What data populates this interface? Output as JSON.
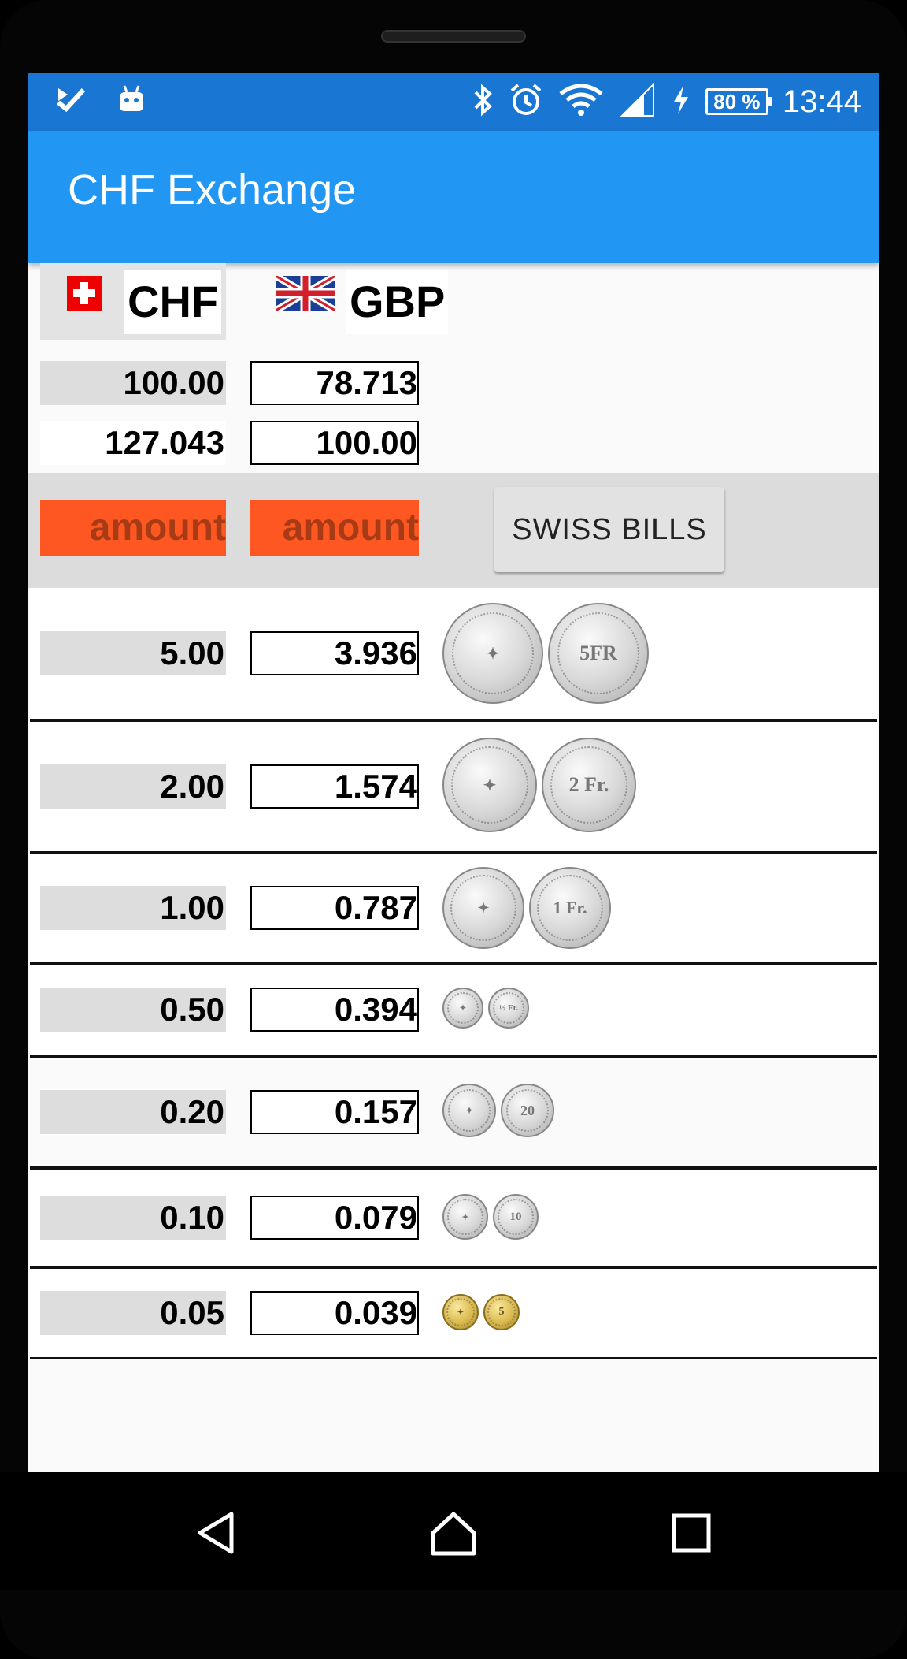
{
  "status_bar": {
    "time": "13:44",
    "battery": "80 %",
    "icons": [
      "check-notification-icon",
      "android-icon",
      "bluetooth-icon",
      "alarm-icon",
      "wifi-icon",
      "signal-icon",
      "charging-icon"
    ]
  },
  "app_bar": {
    "title": "CHF Exchange"
  },
  "currencies": {
    "from": {
      "code": "CHF",
      "flag": "swiss-flag-icon"
    },
    "to": {
      "code": "GBP",
      "flag": "uk-flag-icon"
    }
  },
  "rates": [
    {
      "chf": "100.00",
      "gbp": "78.713"
    },
    {
      "chf": "127.043",
      "gbp": "100.00"
    }
  ],
  "inputs": {
    "chf_placeholder": "amount",
    "gbp_placeholder": "amount",
    "bills_button": "SWISS BILLS"
  },
  "coins": [
    {
      "chf": "5.00",
      "gbp": "3.936",
      "back_label": "5FR",
      "color": "silver"
    },
    {
      "chf": "2.00",
      "gbp": "1.574",
      "back_label": "2 Fr.",
      "color": "silver"
    },
    {
      "chf": "1.00",
      "gbp": "0.787",
      "back_label": "1 Fr.",
      "color": "silver"
    },
    {
      "chf": "0.50",
      "gbp": "0.394",
      "back_label": "½ Fr.",
      "color": "silver"
    },
    {
      "chf": "0.20",
      "gbp": "0.157",
      "back_label": "20",
      "color": "silver"
    },
    {
      "chf": "0.10",
      "gbp": "0.079",
      "back_label": "10",
      "color": "silver"
    },
    {
      "chf": "0.05",
      "gbp": "0.039",
      "back_label": "5",
      "color": "gold"
    }
  ],
  "colors": {
    "status_bar": "#1976d2",
    "app_bar": "#2196f3",
    "amount_input": "#ff5722"
  }
}
